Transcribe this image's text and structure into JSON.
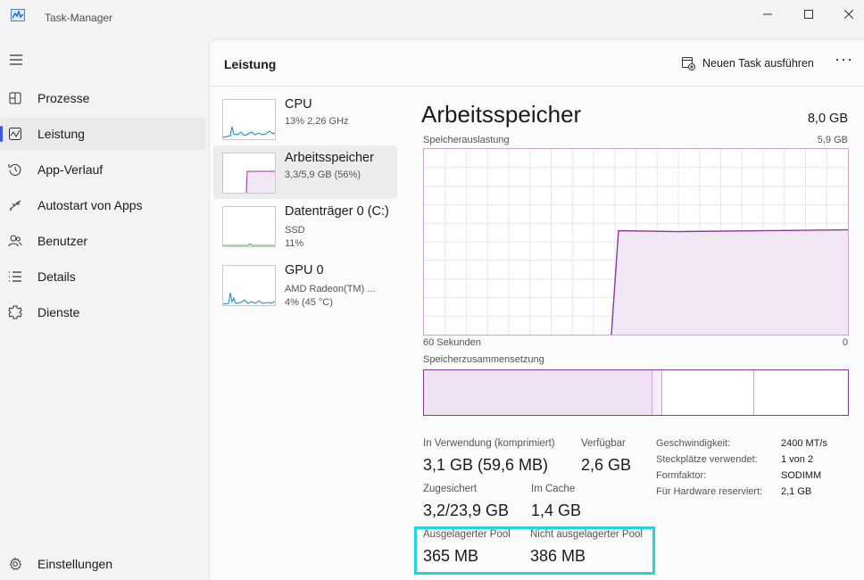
{
  "window": {
    "title": "Task-Manager"
  },
  "sidebar": {
    "items": [
      {
        "label": "Prozesse",
        "icon": "processes-icon"
      },
      {
        "label": "Leistung",
        "icon": "performance-icon",
        "active": true
      },
      {
        "label": "App-Verlauf",
        "icon": "app-history-icon"
      },
      {
        "label": "Autostart von Apps",
        "icon": "startup-icon"
      },
      {
        "label": "Benutzer",
        "icon": "users-icon"
      },
      {
        "label": "Details",
        "icon": "details-icon"
      },
      {
        "label": "Dienste",
        "icon": "services-icon"
      }
    ],
    "settings_label": "Einstellungen"
  },
  "header": {
    "title": "Leistung",
    "run_task_label": "Neuen Task ausführen",
    "more_label": "···"
  },
  "devices": [
    {
      "title": "CPU",
      "line1": "13%  2,26 GHz",
      "line2": ""
    },
    {
      "title": "Arbeitsspeicher",
      "line1": "3,3/5,9 GB (56%)",
      "line2": ""
    },
    {
      "title": "Datenträger 0 (C:)",
      "line1": "SSD",
      "line2": "11%"
    },
    {
      "title": "GPU 0",
      "line1": "AMD Radeon(TM) ...",
      "line2": "4%  (45 °C)"
    }
  ],
  "detail": {
    "title": "Arbeitsspeicher",
    "total": "8,0 GB",
    "usage_label": "Speicherauslastung",
    "usage_max": "5,9 GB",
    "x_left": "60 Sekunden",
    "x_right": "0",
    "composition_label": "Speicherzusammensetzung",
    "usage_fraction": 0.56,
    "composition_fractions": {
      "in_use": 0.537,
      "modified": 0.023,
      "standby": 0.217,
      "free": 0.223
    },
    "stats": {
      "in_use_label": "In Verwendung (komprimiert)",
      "in_use_value": "3,1 GB (59,6 MB)",
      "available_label": "Verfügbar",
      "available_value": "2,6 GB",
      "committed_label": "Zugesichert",
      "committed_value": "3,2/23,9 GB",
      "cached_label": "Im Cache",
      "cached_value": "1,4 GB",
      "paged_pool_label": "Ausgelagerter Pool",
      "paged_pool_value": "365 MB",
      "nonpaged_pool_label": "Nicht ausgelagerter Pool",
      "nonpaged_pool_value": "386 MB"
    },
    "specs": [
      {
        "label": "Geschwindigkeit:",
        "value": "2400 MT/s"
      },
      {
        "label": "Steckplätze verwendet:",
        "value": "1 von 2"
      },
      {
        "label": "Formfaktor:",
        "value": "SODIMM"
      },
      {
        "label": "Für Hardware reserviert:",
        "value": "2,1 GB"
      }
    ]
  },
  "colors": {
    "memory": "#8c3aa2",
    "memory_fill": "#f1e6f4",
    "cpu": "#1e88c7",
    "highlight": "#22d3e0"
  }
}
